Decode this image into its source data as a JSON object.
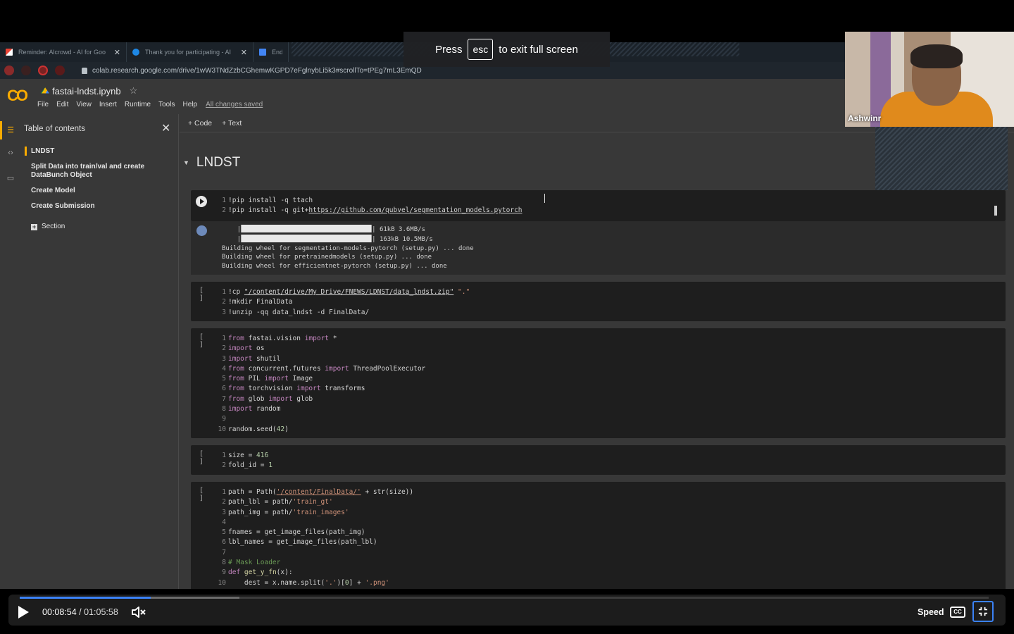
{
  "browser": {
    "tabs": [
      {
        "label": "Reminder: Alcrowd - AI for Goo",
        "icon": "gmail-icon"
      },
      {
        "label": "Thank you for participating - AI",
        "icon": "aicrowd-icon"
      },
      {
        "label": "End-c",
        "icon": "docs-icon"
      }
    ],
    "url": "colab.research.google.com/drive/1wW3TNdZzbCGhemwKGPD7eFglnybLi5k3#scrollTo=tPEg7mL3EmQD"
  },
  "fullscreen_banner": {
    "press": "Press",
    "key": "esc",
    "rest": "to exit full screen"
  },
  "colab": {
    "logo": "CO",
    "notebook_title": "fastai-lndst.ipynb",
    "menu": [
      "File",
      "Edit",
      "View",
      "Insert",
      "Runtime",
      "Tools",
      "Help"
    ],
    "saved_status": "All changes saved",
    "toolbar": {
      "code": "+ Code",
      "text": "+ Text"
    }
  },
  "toc": {
    "title": "Table of contents",
    "items": [
      "LNDST",
      "Split Data into train/val and create DataBunch Object",
      "Create Model",
      "Create Submission"
    ],
    "section": "Section"
  },
  "heading": "LNDST",
  "cells": {
    "c1": {
      "l1": "!pip install -q ttach",
      "l2_a": "!pip install -q git+",
      "l2_b": "https://github.com/qubvel/segmentation_models.pytorch"
    },
    "o1": {
      "l1": "61kB 3.6MB/s",
      "l2": "163kB 10.5MB/s",
      "l3": "Building wheel for segmentation-models-pytorch (setup.py) ... done",
      "l4": "Building wheel for pretrainedmodels (setup.py) ... done",
      "l5": "Building wheel for efficientnet-pytorch (setup.py) ... done"
    },
    "c2": {
      "l1_a": "!cp ",
      "l1_b": "\"/content/drive/My Drive/FNEWS/LDNST/data_lndst.zip\"",
      "l1_c": " \".\"",
      "l2": "!mkdir FinalData",
      "l3": "!unzip -qq data_lndst -d FinalData/"
    },
    "c4": {
      "l1_a": "size = ",
      "l1_b": "416",
      "l2_a": "fold_id = ",
      "l2_b": "1"
    },
    "run_label": "[ ]"
  },
  "webcam": {
    "name": "Ashwinr"
  },
  "player": {
    "current": "00:08:54",
    "total": "01:05:58",
    "speed": "Speed",
    "cc": "CC",
    "progress_fraction": 0.135
  }
}
